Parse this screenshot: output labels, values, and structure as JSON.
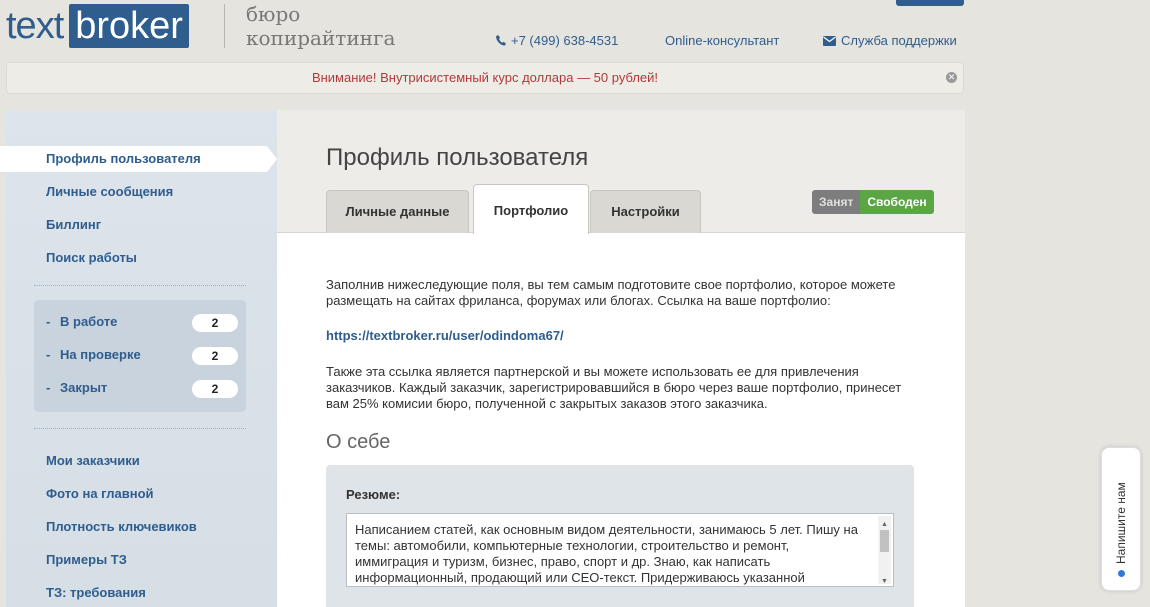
{
  "header": {
    "logo_text": "text",
    "logo_box": "broker",
    "tagline_line1": "бюро",
    "tagline_line2": "копирайтинга",
    "phone_icon": "phone-icon",
    "phone": "+7 (499) 638-4531",
    "online": "Online-консультант",
    "support_icon": "envelope-icon",
    "support": "Служба поддержки"
  },
  "notice": {
    "text": "Внимание! Внутрисистемный курс доллара — 50 рублей!",
    "close_icon": "close-icon"
  },
  "sidebar": {
    "items": [
      {
        "label": "Профиль пользователя"
      },
      {
        "label": "Личные сообщения"
      },
      {
        "label": "Биллинг"
      },
      {
        "label": "Поиск работы"
      }
    ],
    "stats": [
      {
        "label": "В работе",
        "count": "2"
      },
      {
        "label": "На проверке",
        "count": "2"
      },
      {
        "label": "Закрыт",
        "count": "2"
      }
    ],
    "links": [
      {
        "label": "Мои заказчики"
      },
      {
        "label": "Фото на главной"
      },
      {
        "label": "Плотность ключевиков"
      },
      {
        "label": "Примеры ТЗ"
      },
      {
        "label": "ТЗ: требования"
      }
    ]
  },
  "main": {
    "title": "Профиль пользователя",
    "tabs": [
      {
        "label": "Личные данные"
      },
      {
        "label": "Портфолио"
      },
      {
        "label": "Настройки"
      }
    ],
    "status": {
      "busy": "Занят",
      "free": "Свободен"
    },
    "intro_line1": "Заполнив нижеследующие поля, вы тем самым подготовите свое портфолио, которое можете",
    "intro_line2": "размещать на сайтах фриланса, форумах или блогах. Ссылка на ваше портфолио:",
    "portfolio_link": "https://textbroker.ru/user/odindoma67/",
    "partner_line1": "Также эта ссылка является партнерской и вы можете использовать ее для привлечения",
    "partner_line2": "заказчиков. Каждый заказчик, зарегистрировавшийся в бюро через ваше портфолио, принесет",
    "partner_line3": "вам 25% комисии бюро, полученной с закрытых заказов этого заказчика.",
    "about_title": "О себе",
    "resume_label": "Резюме:",
    "resume_text": "Написанием статей, как основным видом деятельности, занимаюсь 5 лет. Пишу на темы: автомобили, компьютерные технологии, строительство и ремонт, иммиграция и туризм, бизнес, право, спорт и др. Знаю, как написать информационный, продающий или СЕО-текст. Придерживаюсь указанной"
  },
  "feedback": {
    "label": "Напишите нам"
  },
  "colors": {
    "brand": "#2e5d8e",
    "notice": "#b03a3a",
    "free": "#5aa645",
    "busy": "#7d7d7d"
  }
}
